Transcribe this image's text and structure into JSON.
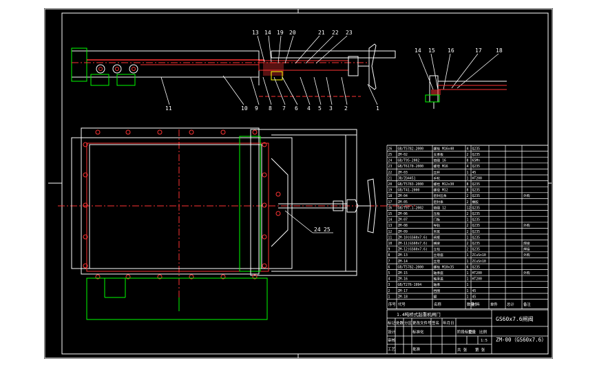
{
  "drawing": {
    "title_main": "GS60x7.6闸阀",
    "title_sub": "1.4吨桥式起重机闸门",
    "drawing_no": "ZM-00（GS60x7.6）",
    "scale": "1:5",
    "rev": "A"
  },
  "callouts_top": [
    "13",
    "14",
    "19",
    "20",
    "21",
    "22",
    "23"
  ],
  "callouts_bottom": [
    "11",
    "10",
    "9",
    "8",
    "7",
    "6",
    "4",
    "5",
    "3",
    "2",
    "1"
  ],
  "callouts_detail": [
    "14",
    "15",
    "16",
    "17",
    "18"
  ],
  "callouts_plan": [
    "24",
    "25"
  ],
  "bom_header": [
    "序号",
    "代号",
    "名称",
    "数量",
    "材料",
    "单件",
    "总计",
    "备注"
  ],
  "bom_rows": [
    [
      "26",
      "GB/T5782-2000",
      "螺栓 M16x40",
      "4",
      "Q235",
      ""
    ],
    [
      "25",
      "ZM-02",
      "支承板",
      "2",
      "Q235",
      ""
    ],
    [
      "24",
      "GB/T95-2002",
      "垫圈 16",
      "8",
      "65Mn",
      ""
    ],
    [
      "23",
      "GB/T6170-2000",
      "螺母 M16",
      "4",
      "Q235",
      ""
    ],
    [
      "22",
      "ZM-03",
      "丝杆",
      "1",
      "45",
      ""
    ],
    [
      "21",
      "JB/ZQ4451",
      "手轮",
      "1",
      "HT200",
      ""
    ],
    [
      "20",
      "GB/T5783-2000",
      "螺栓 M12x30",
      "8",
      "Q235",
      ""
    ],
    [
      "19",
      "GB/T41-2000",
      "螺母 M12",
      "8",
      "Q235",
      ""
    ],
    [
      "18",
      "ZM-04",
      "密封压条",
      "2",
      "Q235",
      "外购"
    ],
    [
      "17",
      "ZM-05",
      "密封条",
      "2",
      "橡胶",
      ""
    ],
    [
      "16",
      "GB/T97.1-2002",
      "垫圈 12",
      "12",
      "Q235",
      ""
    ],
    [
      "15",
      "ZM-06",
      "压板",
      "2",
      "Q235",
      ""
    ],
    [
      "14",
      "ZM-07",
      "门板",
      "1",
      "Q235",
      ""
    ],
    [
      "13",
      "ZM-08",
      "导轨",
      "2",
      "Q235",
      "外购"
    ],
    [
      "12",
      "ZM-09",
      "吊耳",
      "2",
      "Q235",
      ""
    ],
    [
      "11",
      "ZM-10(GS60x7.6)",
      "闸框",
      "1",
      "Q235",
      ""
    ],
    [
      "10",
      "ZM-11(GS60x7.6)",
      "横梁",
      "2",
      "Q235",
      "焊接"
    ],
    [
      "9",
      "ZM-12(GS60x7.6)",
      "立柱",
      "2",
      "Q235",
      "焊接"
    ],
    [
      "8",
      "ZM-13",
      "丝母座",
      "1",
      "ZCuSn10",
      "外购"
    ],
    [
      "7",
      "ZM-14",
      "丝母",
      "1",
      "ZCuSn10",
      ""
    ],
    [
      "6",
      "GB/T5782-2000",
      "螺栓 M10x35",
      "6",
      "Q235",
      ""
    ],
    [
      "5",
      "ZM-15",
      "轴承座",
      "1",
      "HT200",
      "外购"
    ],
    [
      "4",
      "ZM-16",
      "轴承盖",
      "1",
      "HT200",
      ""
    ],
    [
      "3",
      "GB/T276-1994",
      "轴承",
      "1",
      "",
      ""
    ],
    [
      "2",
      "ZM-17",
      "挡圈",
      "1",
      "45",
      ""
    ],
    [
      "1",
      "ZM-18",
      "键",
      "1",
      "45",
      ""
    ]
  ],
  "title_block": {
    "row_labels": [
      "标记",
      "处数",
      "分区",
      "更改文件号",
      "签名",
      "年月日"
    ],
    "design": "设计",
    "standard": "标准化",
    "check": "审核",
    "process": "工艺",
    "approve": "批准",
    "stage": "阶段标记",
    "weight": "重量",
    "scale_label": "比例",
    "sheets": "共 张",
    "sheet": "第 张"
  }
}
